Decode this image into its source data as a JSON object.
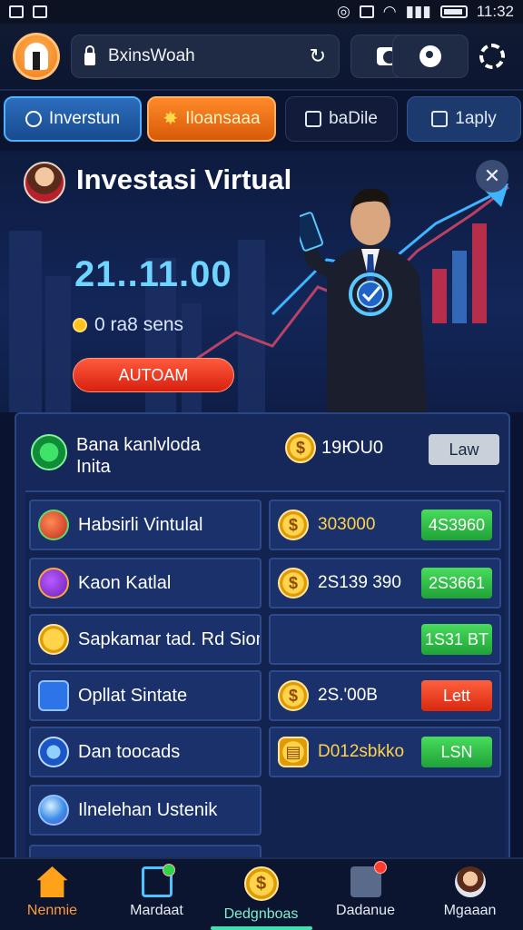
{
  "status_bar": {
    "time": "11:32"
  },
  "top_bar": {
    "address": "BxinsWoah"
  },
  "tabs": [
    {
      "label": "Inverstun"
    },
    {
      "label": "Iloansaaa"
    },
    {
      "label": "baDile"
    },
    {
      "label": "1aply"
    }
  ],
  "hero": {
    "title": "Investasi Virtual",
    "value": "21..11.00",
    "subtitle": "0 ra8 sens",
    "button_label": "AUTOAM"
  },
  "panel": {
    "header": {
      "title_line1": "Bana kanlvloda",
      "title_line2": "Inita",
      "value": "19ЮU0",
      "button_label": "Law"
    },
    "left_rows": [
      {
        "label": "Habsirli Vintulal",
        "icon": "tomato-icon"
      },
      {
        "label": "Kaon Katlal",
        "icon": "grape-icon"
      },
      {
        "label": "Sapkamar tad. Rd Sion",
        "icon": "coin-icon"
      },
      {
        "label": "Opllat Sintate",
        "icon": "calculator-icon"
      },
      {
        "label": "Dan toocads",
        "icon": "swap-icon"
      },
      {
        "label": "Ilnelehan Ustenik",
        "icon": "globe-icon"
      }
    ],
    "right_rows": [
      {
        "value": "303000",
        "button_label": "4S3960",
        "button_color": "#2fbf4a"
      },
      {
        "value": "2S139 390",
        "button_label": "2S3661",
        "button_color": "#2fbf4a"
      },
      {
        "value": "",
        "button_label": "1S31 BT",
        "button_color": "#2fbf4a"
      },
      {
        "value": "2S.'00B",
        "button_label": "Lett",
        "button_color": "#e8401f"
      },
      {
        "value": "D012sbkko",
        "button_label": "LSN",
        "button_color": "#2fbf4a"
      }
    ]
  },
  "bottom_nav": [
    {
      "label": "Nenmie",
      "icon": "home-icon"
    },
    {
      "label": "Mardaat",
      "icon": "edit-icon"
    },
    {
      "label": "Dedgnboas",
      "icon": "coin-icon"
    },
    {
      "label": "Dadanue",
      "icon": "grid-icon"
    },
    {
      "label": "Mgaaan",
      "icon": "avatar-icon"
    }
  ],
  "colors": {
    "accent_teal": "#42e0b0",
    "accent_orange": "#ff8a2a",
    "panel_bg": "#16285a"
  }
}
